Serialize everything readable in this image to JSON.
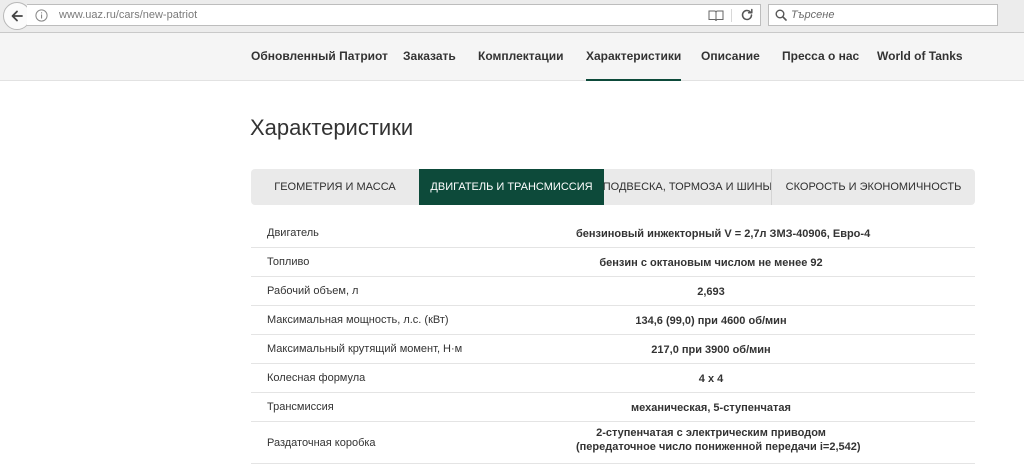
{
  "browser": {
    "url": "www.uaz.ru/cars/new-patriot",
    "search_placeholder": "Търсене"
  },
  "nav": {
    "items": [
      {
        "label": "Обновленный Патриот"
      },
      {
        "label": "Заказать"
      },
      {
        "label": "Комплектации"
      },
      {
        "label": "Характеристики",
        "active": true
      },
      {
        "label": "Описание"
      },
      {
        "label": "Пресса о нас"
      },
      {
        "label": "World of Tanks"
      }
    ]
  },
  "page": {
    "title": "Характеристики"
  },
  "tabs": [
    {
      "label": "ГЕОМЕТРИЯ И МАССА"
    },
    {
      "label": "ДВИГАТЕЛЬ И ТРАНСМИССИЯ",
      "active": true
    },
    {
      "label": "ПОДВЕСКА, ТОРМОЗА И ШИНЫ"
    },
    {
      "label": "СКОРОСТЬ И ЭКОНОМИЧНОСТЬ"
    }
  ],
  "specs": [
    {
      "label": "Двигатель",
      "value": "бензиновый инжекторный V = 2,7л ЗМЗ-40906, Евро-4"
    },
    {
      "label": "Топливо",
      "value": "бензин с октановым числом не менее 92"
    },
    {
      "label": "Рабочий объем, л",
      "value": "2,693"
    },
    {
      "label": "Максимальная мощность, л.с. (кВт)",
      "value": "134,6 (99,0) при 4600 об/мин"
    },
    {
      "label": "Максимальный крутящий момент, Н·м",
      "value": "217,0 при 3900 об/мин"
    },
    {
      "label": "Колесная формула",
      "value": "4 x 4"
    },
    {
      "label": "Трансмиссия",
      "value": "механическая, 5-ступенчатая"
    },
    {
      "label": "Раздаточная коробка",
      "value": "2-ступенчатая с электрическим приводом",
      "value2": "(передаточное число пониженной передачи i=2,542)"
    }
  ],
  "colors": {
    "accent": "#0d4a3a",
    "tab_bg": "#eaeaea",
    "nav_bg": "#f5f5f5"
  }
}
